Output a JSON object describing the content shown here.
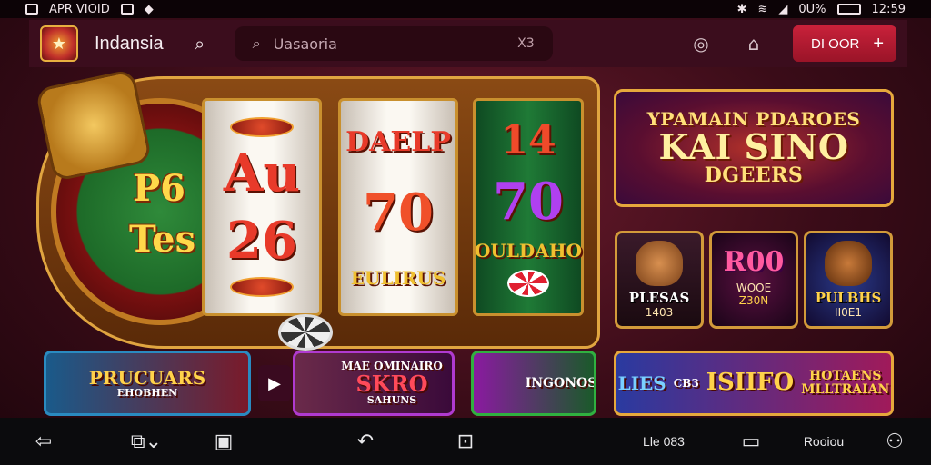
{
  "status_bar": {
    "left_text": "APR VIOID",
    "battery": "0U%",
    "time": "12:59"
  },
  "header": {
    "brand": "Indansia",
    "search_placeholder": "Uasaoria",
    "search_trailing": "X3",
    "cta_label": "DI OOR",
    "cta_plus": "+"
  },
  "slot": {
    "wheel_label_1": "P6",
    "wheel_label_2": "Tes",
    "reel1": [
      "Au",
      "26"
    ],
    "reel2": [
      "DAELP",
      "70",
      "EULIRUS"
    ],
    "reel3": [
      "14",
      "70",
      "OULDAHO"
    ]
  },
  "promo": {
    "line1": "YPAMAIN PDAROES",
    "line2": "KAI SINO",
    "line3": "DGEERS"
  },
  "mid_tiles": [
    {
      "title": "PLESAS",
      "sub": "1403"
    },
    {
      "title": "R00",
      "label": "WOOE",
      "sub": "Z30N"
    },
    {
      "title": "PULBHS",
      "sub": "II0E1"
    }
  ],
  "bottom_tiles": [
    {
      "title": "PRUCUARS",
      "sub": "EHOBHEN"
    },
    {
      "title": "MAE OMINAIRO",
      "big": "SKRO",
      "sub": "SAHUNS"
    },
    {
      "title": "INGONOS"
    },
    {
      "title": "LIES",
      "badge": "CB3",
      "big": "ISIIFO",
      "right1": "HOTAENS",
      "right2": "MLLTRAIAN"
    }
  ],
  "navbar": {
    "text1": "Lle 083",
    "text2": "Rooiou"
  },
  "colors": {
    "background": "#3a0c18",
    "header": "#3b0d1d",
    "accent": "#c8213a",
    "gold": "#e0a540"
  }
}
